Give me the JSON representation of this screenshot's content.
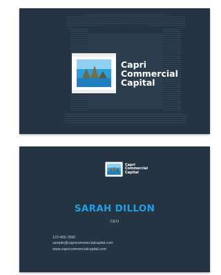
{
  "front": {
    "logo_lines": [
      "Capri",
      "Commercial",
      "Capital"
    ]
  },
  "back": {
    "logo_lines": [
      "Capri",
      "Commercial",
      "Capital"
    ],
    "name": "SARAH DILLON",
    "title": "CEO",
    "contact": {
      "phone": "123-456-7890",
      "email": "sample@capricommercialcapital.com",
      "website": "www.capricommercialcapital.com"
    }
  },
  "colors": {
    "card_background": "#253442",
    "name_accent": "#1f9fe4",
    "text_light": "#c9d2db"
  },
  "icons": [
    "temple-watermark",
    "capri-logo-badge"
  ]
}
